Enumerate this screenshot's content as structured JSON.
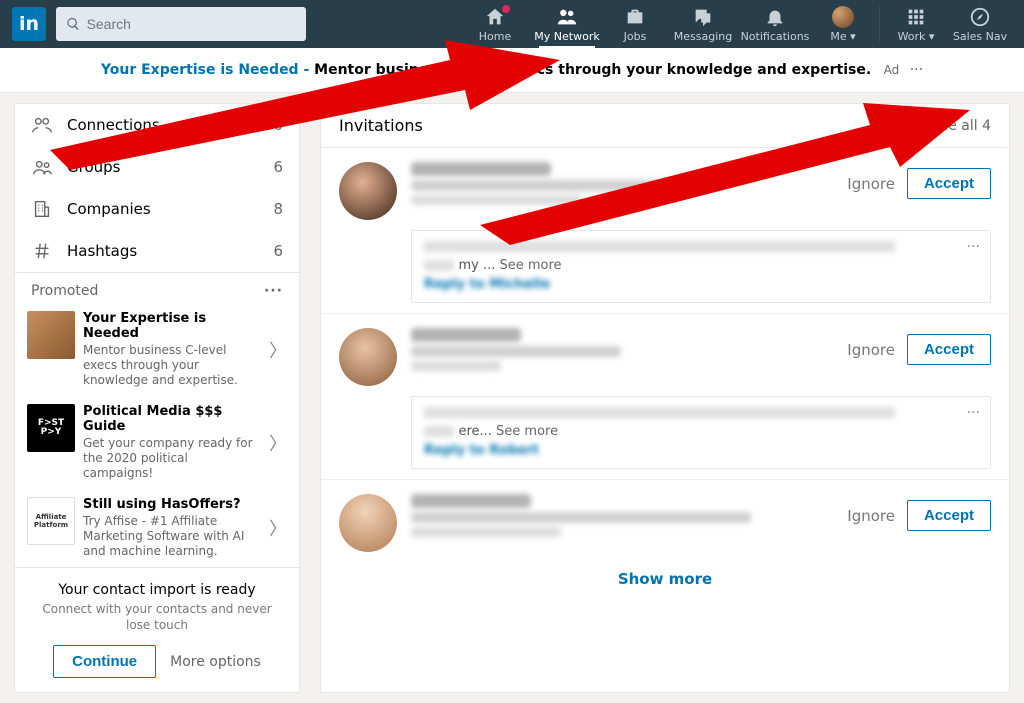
{
  "nav": {
    "logo_text": "in",
    "search_placeholder": "Search",
    "items": {
      "home": "Home",
      "network": "My Network",
      "jobs": "Jobs",
      "messaging": "Messaging",
      "notifications": "Notifications",
      "me": "Me ▾",
      "work": "Work ▾",
      "sales": "Sales Nav"
    }
  },
  "adbar": {
    "link": "Your Expertise is Needed - ",
    "bold": "Mentor business C-level execs through your knowledge and expertise.",
    "tag": "Ad",
    "ell": "···"
  },
  "sidebar": {
    "rows": [
      {
        "label": "Connections",
        "count": "1,060"
      },
      {
        "label": "Groups",
        "count": "6"
      },
      {
        "label": "Companies",
        "count": "8"
      },
      {
        "label": "Hashtags",
        "count": "6"
      }
    ],
    "promoted_label": "Promoted",
    "ell": "···",
    "promos": [
      {
        "title": "Your Expertise is Needed",
        "desc": "Mentor business C-level execs through your knowledge and expertise."
      },
      {
        "title": "Political Media $$$ Guide",
        "desc": "Get your company ready for the 2020 political campaigns!",
        "badge": "F>ST\nP>Y"
      },
      {
        "title": "Still using HasOffers?",
        "desc": "Try Affise - #1 Affiliate Marketing Software with AI and machine learning.",
        "badge": "Affiliate\nPlatform"
      }
    ],
    "import": {
      "title": "Your contact import is ready",
      "desc": "Connect with your contacts and never lose touch",
      "continue": "Continue",
      "more": "More options"
    }
  },
  "invitations": {
    "title": "Invitations",
    "see_all": "See all 4",
    "ignore": "Ignore",
    "accept": "Accept",
    "show_more": "Show more",
    "see_more": "See more",
    "ell": "···",
    "items": [
      {
        "tail": "my ..."
      },
      {
        "tail": "ere..."
      },
      {
        "tail": ""
      }
    ]
  }
}
